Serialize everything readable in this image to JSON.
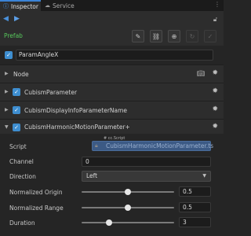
{
  "tabs": [
    {
      "label": "Inspector",
      "icon": "info-icon",
      "active": true
    },
    {
      "label": "Service",
      "icon": "cloud-icon",
      "active": false
    }
  ],
  "toolbar": {
    "menu_icon": "kebab-menu-icon"
  },
  "nav": {
    "back_icon": "arrow-left-icon",
    "forward_icon": "arrow-right-icon",
    "lock_icon": "lock-icon"
  },
  "prefab": {
    "label": "Prefab",
    "buttons": [
      "edit-icon",
      "link-icon",
      "target-icon",
      "revert-icon",
      "apply-icon"
    ]
  },
  "node_name": {
    "value": "ParamAngleX",
    "enabled": true
  },
  "sections": [
    {
      "title": "Node",
      "expanded": false,
      "has_checkbox": false
    },
    {
      "title": "CubismParameter",
      "expanded": false,
      "has_checkbox": true
    },
    {
      "title": "CubismDisplayInfoParameterName",
      "expanded": false,
      "has_checkbox": true
    },
    {
      "title": "CubismHarmonicMotionParameter+",
      "expanded": true,
      "has_checkbox": true
    }
  ],
  "component": {
    "script": {
      "label": "Script",
      "tag": "# cc.Script",
      "value": "CubismHarmonicMotionParameter.ts"
    },
    "channel": {
      "label": "Channel",
      "value": "0"
    },
    "direction": {
      "label": "Direction",
      "value": "Left"
    },
    "normalized_origin": {
      "label": "Normalized Origin",
      "value": "0.5",
      "level": 0.5
    },
    "normalized_range": {
      "label": "Normalized Range",
      "value": "0.5",
      "level": 0.5
    },
    "duration": {
      "label": "Duration",
      "value": "3",
      "level": 0.3
    }
  },
  "colors": {
    "accent": "#3b83d6",
    "prefab": "#57c85c",
    "background": "#252525",
    "panel": "#2d2d2d"
  }
}
